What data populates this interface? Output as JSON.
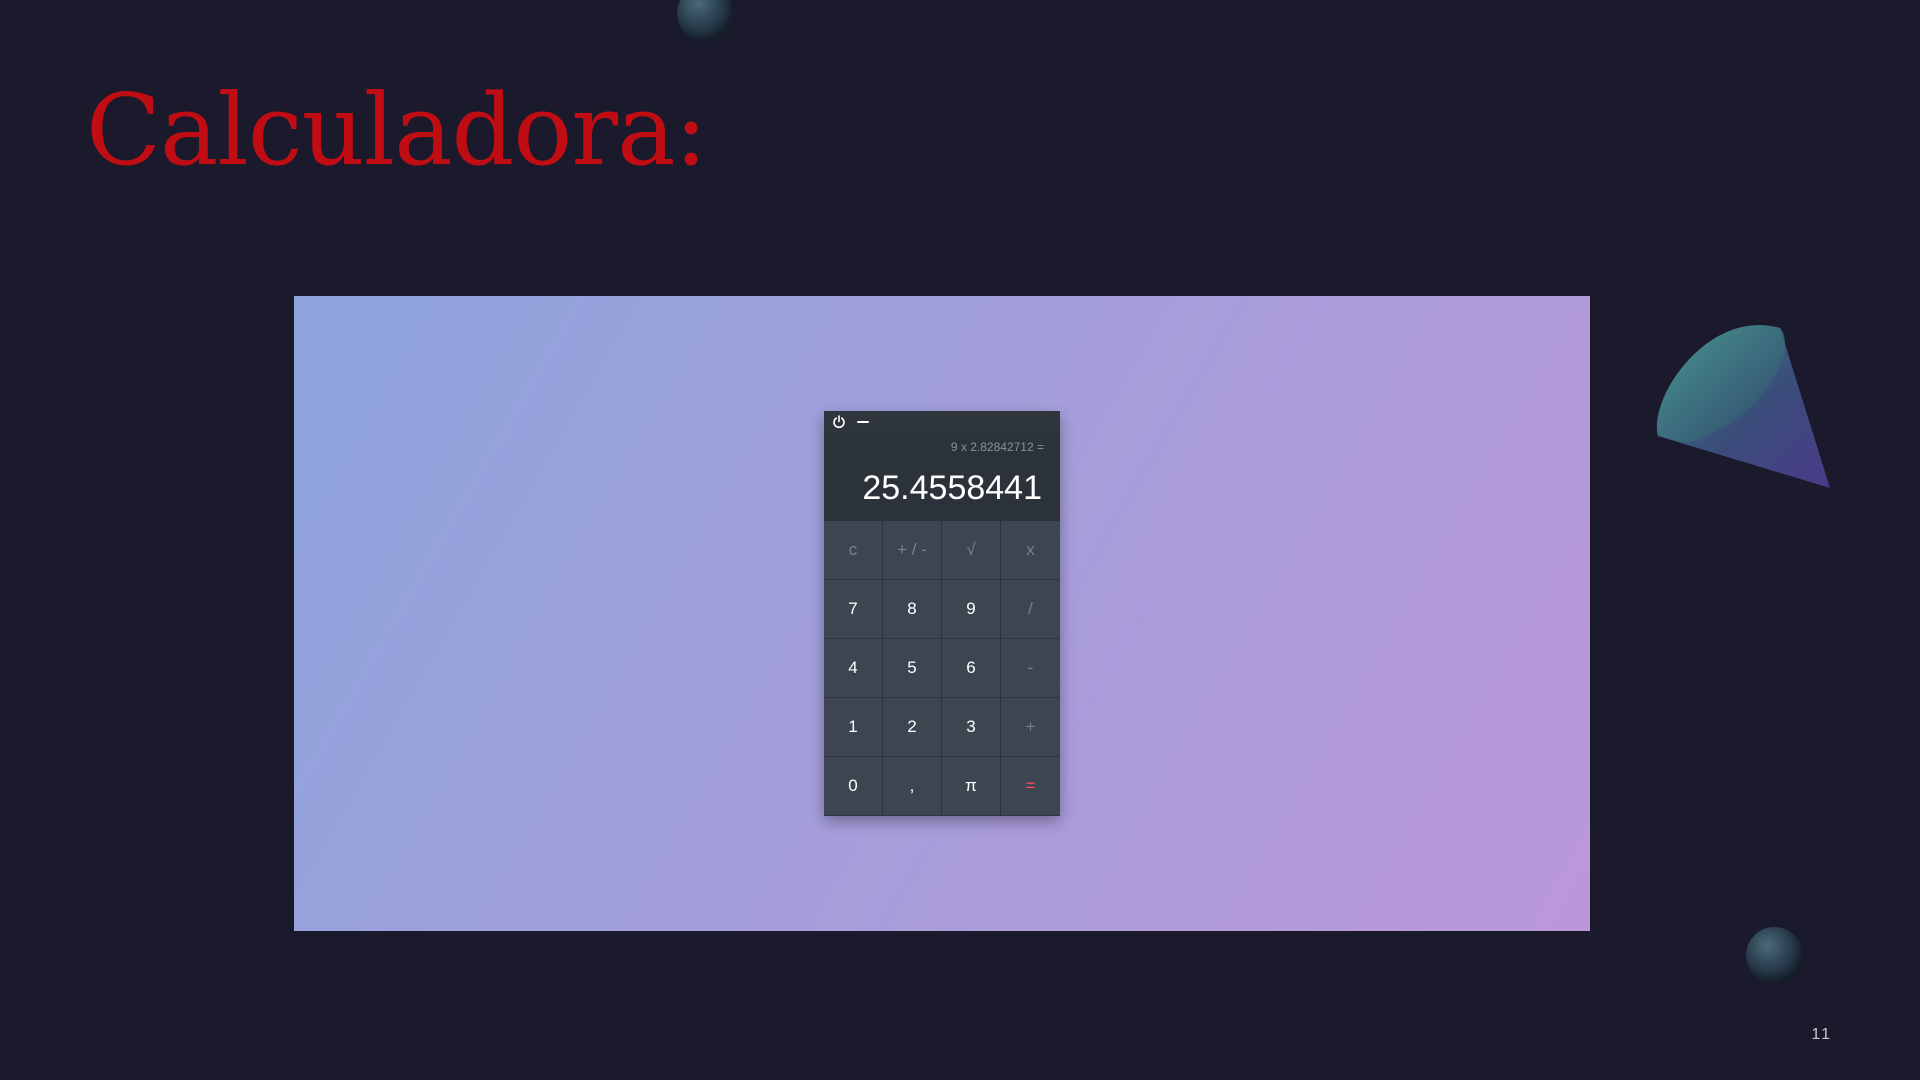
{
  "slide": {
    "title": "Calculadora:",
    "page_number": "11"
  },
  "calculator": {
    "titlebar": {
      "power_icon": "power-icon",
      "minimize_icon": "minimize-icon"
    },
    "display": {
      "expression": "9 x 2.82842712 =",
      "result": "25.4558441"
    },
    "keys": [
      {
        "label": "c",
        "kind": "func"
      },
      {
        "label": "+ / -",
        "kind": "func"
      },
      {
        "label": "√",
        "kind": "func"
      },
      {
        "label": "x",
        "kind": "op"
      },
      {
        "label": "7",
        "kind": "digit"
      },
      {
        "label": "8",
        "kind": "digit"
      },
      {
        "label": "9",
        "kind": "digit"
      },
      {
        "label": "/",
        "kind": "op"
      },
      {
        "label": "4",
        "kind": "digit"
      },
      {
        "label": "5",
        "kind": "digit"
      },
      {
        "label": "6",
        "kind": "digit"
      },
      {
        "label": "-",
        "kind": "op"
      },
      {
        "label": "1",
        "kind": "digit"
      },
      {
        "label": "2",
        "kind": "digit"
      },
      {
        "label": "3",
        "kind": "digit"
      },
      {
        "label": "+",
        "kind": "op"
      },
      {
        "label": "0",
        "kind": "digit"
      },
      {
        "label": ",",
        "kind": "digit"
      },
      {
        "label": "π",
        "kind": "digit"
      },
      {
        "label": "=",
        "kind": "equals"
      }
    ]
  },
  "colors": {
    "background": "#1b192c",
    "title": "#c00d13",
    "equals": "#ff4d5e"
  }
}
